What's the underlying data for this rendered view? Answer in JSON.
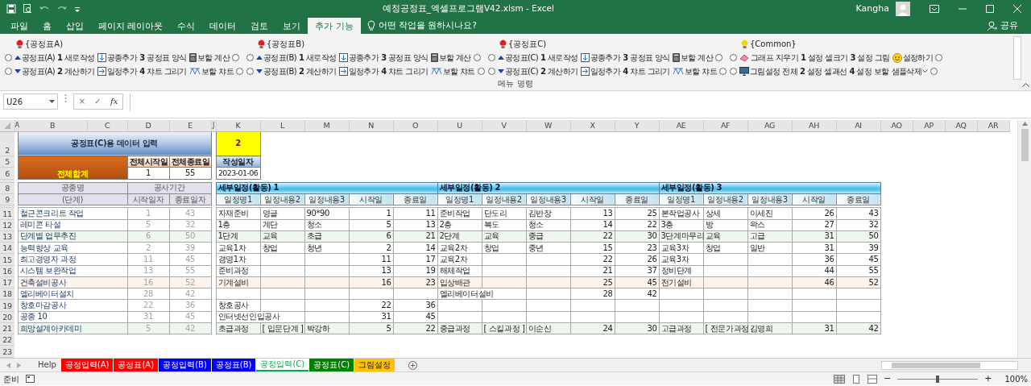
{
  "title_bar": {
    "title": "예정공정표_엑셀프로그램V42.xlsm  -  Excel",
    "user": "Kangha"
  },
  "menu_tabs": [
    {
      "label": "파일",
      "selected": false
    },
    {
      "label": "홈",
      "selected": false
    },
    {
      "label": "삽입",
      "selected": false
    },
    {
      "label": "페이지 레이아웃",
      "selected": false
    },
    {
      "label": "수식",
      "selected": false
    },
    {
      "label": "데이터",
      "selected": false
    },
    {
      "label": "검토",
      "selected": false
    },
    {
      "label": "보기",
      "selected": false
    },
    {
      "label": "추가 기능",
      "selected": true
    }
  ],
  "tell_me": "어떤 작업을 원하시나요?",
  "share": "공유",
  "ribbon": {
    "group_label": "메뉴 명령",
    "groups": [
      {
        "heading": "{공정표A)",
        "color": "#e02020",
        "rows": [
          {
            "left_checked": false,
            "right_checked": false,
            "items": [
              {
                "label": "공정표(A)",
                "kind": "up"
              },
              {
                "label": "**1** 새로작성",
                "kind": "command"
              },
              {
                "label": "공종추가",
                "kind": "insert-down"
              },
              {
                "label": "**3** 공정표 양식",
                "kind": "command"
              },
              {
                "label": "보할 계산",
                "kind": "calc"
              }
            ]
          },
          {
            "left_checked": false,
            "right_checked": false,
            "items": [
              {
                "label": "공정표(A)",
                "kind": "down"
              },
              {
                "label": "**2** 계산하기",
                "kind": "command"
              },
              {
                "label": "일정추가",
                "kind": "insert-right"
              },
              {
                "label": "**4** 챠트 그리기",
                "kind": "command"
              },
              {
                "label": "보할 챠트",
                "kind": "chart"
              }
            ]
          }
        ]
      },
      {
        "heading": "{공정표B)",
        "color": "#e02020",
        "rows": [
          {
            "left_checked": false,
            "right_checked": false,
            "items": [
              {
                "label": "공정표(B)",
                "kind": "up"
              },
              {
                "label": "**1** 새로작성",
                "kind": "command"
              },
              {
                "label": "공종추가",
                "kind": "insert-down"
              },
              {
                "label": "**3** 공정표 양식",
                "kind": "command"
              },
              {
                "label": "보할 계산",
                "kind": "calc"
              }
            ]
          },
          {
            "left_checked": false,
            "right_checked": false,
            "items": [
              {
                "label": "공정표(B)",
                "kind": "down"
              },
              {
                "label": "**2** 계산하기",
                "kind": "command"
              },
              {
                "label": "일정추가",
                "kind": "insert-right"
              },
              {
                "label": "**4** 챠트 그리기",
                "kind": "command"
              },
              {
                "label": "보할 챠트",
                "kind": "chart"
              }
            ]
          }
        ]
      },
      {
        "heading": "{공정표C)",
        "color": "#e02020",
        "rows": [
          {
            "left_checked": false,
            "right_checked": false,
            "items": [
              {
                "label": "공정표(C)",
                "kind": "up"
              },
              {
                "label": "**1** 새로작성",
                "kind": "command"
              },
              {
                "label": "공종추가",
                "kind": "insert-down"
              },
              {
                "label": "**3** 공정표 양식",
                "kind": "command"
              },
              {
                "label": "보할 계산",
                "kind": "calc"
              }
            ]
          },
          {
            "left_checked": false,
            "right_checked": false,
            "items": [
              {
                "label": "공정표(C)",
                "kind": "down"
              },
              {
                "label": "**2** 계산하기",
                "kind": "command"
              },
              {
                "label": "일정추가",
                "kind": "insert-right"
              },
              {
                "label": "**4** 챠트 그리기",
                "kind": "command"
              },
              {
                "label": "보할 챠트",
                "kind": "chart"
              }
            ]
          }
        ]
      },
      {
        "heading": "{Common}",
        "color": "#f5d800",
        "rows": [
          {
            "left_checked": false,
            "right_checked": false,
            "items": [
              {
                "label": "그래프 지우기",
                "kind": "eraser"
              },
              {
                "label": "**1** 설정 셀크기",
                "kind": "command"
              },
              {
                "label": "**3** 설정 그림",
                "kind": "command"
              },
              {
                "label": "설정하기",
                "kind": "smiley"
              }
            ]
          },
          {
            "left_checked": false,
            "right_checked": false,
            "items": [
              {
                "label": "그림설정 전체",
                "kind": "monitor"
              },
              {
                "label": "**2** 설정 셀괘선",
                "kind": "command"
              },
              {
                "label": "**4** 설정 보할",
                "kind": "command"
              },
              {
                "label": "샘플삭제",
                "kind": "dropdown"
              }
            ]
          }
        ]
      }
    ]
  },
  "formula_bar": {
    "name_box": "U26",
    "cancel": "×",
    "enter": "✓",
    "function": "fx"
  },
  "sheet": {
    "columns": [
      "A",
      "B",
      "C",
      "D",
      "E",
      "J",
      "K",
      "L",
      "M",
      "N",
      "O",
      "U",
      "V",
      "W",
      "X",
      "Y",
      "AE",
      "AF",
      "AG",
      "AH",
      "AI",
      "AO",
      "AP",
      "AQ",
      "AR"
    ],
    "row_numbers": [
      "2",
      "5",
      "6",
      "8",
      "9",
      "11",
      "12",
      "13",
      "14",
      "15",
      "16",
      "17",
      "18",
      "19",
      "20",
      "21",
      "22",
      "23"
    ],
    "header": {
      "title": "공정표(C)용 데이터 입력",
      "counter": "2",
      "summary_label": "전체합계",
      "start_label": "전체시작일",
      "end_label": "전체종료일",
      "start": "1",
      "end": "55",
      "date_label": "작성일자",
      "date": "2023-01-06"
    },
    "left_table": {
      "name_header": "공종명",
      "name_subheader": "(단계)",
      "period_header": "공사기간",
      "start_header": "시작일자",
      "end_header": "종료일자",
      "rows": [
        {
          "name": "철근콘크리트 작업",
          "start": "1",
          "end": "43"
        },
        {
          "name": "레미콘 타설",
          "start": "5",
          "end": "32"
        },
        {
          "name": "단계별 업무추진",
          "start": "6",
          "end": "50",
          "color": "#edf7ee"
        },
        {
          "name": "능력향상 교육",
          "start": "2",
          "end": "39"
        },
        {
          "name": "최고경영자 과정",
          "start": "11",
          "end": "45"
        },
        {
          "name": "시스템 보완작업",
          "start": "13",
          "end": "55"
        },
        {
          "name": "건축설비공사",
          "start": "16",
          "end": "52",
          "color": "#fdf3ec"
        },
        {
          "name": "엘리베이터설치",
          "start": "28",
          "end": "42"
        },
        {
          "name": "창호마감공사",
          "start": "22",
          "end": "36"
        },
        {
          "name": "공종 10",
          "start": "31",
          "end": "45"
        },
        {
          "name": "희망설계아카데미",
          "start": "5",
          "end": "42",
          "color": "#edf7ee"
        }
      ]
    },
    "blocks": [
      {
        "title": "세부일정(활동) 1",
        "columns": [
          "일정명1",
          "일정내용2",
          "일정내용3",
          "시작일",
          "종료일"
        ],
        "rows": [
          {
            "kind": "task",
            "name": "자재준비",
            "content2": "영글",
            "content3": "90*90",
            "start": "1",
            "end": "11"
          },
          {
            "kind": "task",
            "name": "1층",
            "content2": "계단",
            "content3": "청소",
            "start": "5",
            "end": "13"
          },
          {
            "kind": "task",
            "name": "1단계",
            "content2": "교육",
            "content3": "초급",
            "start": "6",
            "end": "21",
            "color": "#edf7ee"
          },
          {
            "kind": "task",
            "name": "교육1차",
            "content2": "창업",
            "content3": "청년",
            "start": "2",
            "end": "14"
          },
          {
            "kind": "task",
            "name": "경영1차",
            "start": "11",
            "end": "17"
          },
          {
            "kind": "task",
            "name": "준비과정",
            "start": "13",
            "end": "19"
          },
          {
            "kind": "task",
            "name": "기계설비",
            "start": "16",
            "end": "23",
            "color": "#fdf3ec"
          },
          {
            "kind": "task"
          },
          {
            "kind": "task",
            "name": "창호공사",
            "start": "22",
            "end": "36"
          },
          {
            "kind": "task",
            "name": "인터넷선인입공사",
            "start": "31",
            "end": "45"
          },
          {
            "kind": "summary",
            "name": "초급과정",
            "content2": "[ 입문단계 ]",
            "content3": "박강하",
            "start": "5",
            "end": "22",
            "color": "#edf7ee"
          }
        ]
      },
      {
        "title": "세부일정(활동) 2",
        "columns": [
          "일정명1",
          "일정내용2",
          "일정내용3",
          "시작일",
          "종료일"
        ],
        "rows": [
          {
            "kind": "task",
            "name": "준비작업",
            "content2": "단도리",
            "content3": "김반장",
            "start": "13",
            "end": "25"
          },
          {
            "kind": "task",
            "name": "2층",
            "content2": "복도",
            "content3": "청소",
            "start": "14",
            "end": "22"
          },
          {
            "kind": "task",
            "name": "2단계",
            "content2": "교육",
            "content3": "중급",
            "start": "22",
            "end": "30",
            "color": "#edf7ee"
          },
          {
            "kind": "task",
            "name": "교육2차",
            "content2": "창업",
            "content3": "중년",
            "start": "15",
            "end": "23"
          },
          {
            "kind": "task",
            "name": "교육2차",
            "start": "22",
            "end": "26"
          },
          {
            "kind": "task",
            "name": "해체작업",
            "start": "21",
            "end": "37"
          },
          {
            "kind": "task",
            "name": "입상배관",
            "start": "25",
            "end": "45",
            "color": "#fdf3ec"
          },
          {
            "kind": "task",
            "name": "엘리베이터설비",
            "start": "28",
            "end": "42"
          },
          {
            "kind": "task"
          },
          {
            "kind": "task"
          },
          {
            "kind": "summary",
            "name": "중급과정",
            "content2": "[ 스킬과정 ]",
            "content3": "이순신",
            "start": "24",
            "end": "30",
            "color": "#edf7ee"
          }
        ]
      },
      {
        "title": "세부일정(활동) 3",
        "columns": [
          "일정명1",
          "일정내용2",
          "일정내용3",
          "시작일",
          "종료일"
        ],
        "rows": [
          {
            "kind": "task",
            "name": "본작업공사",
            "content2": "상세",
            "content3": "이세진",
            "start": "26",
            "end": "43"
          },
          {
            "kind": "task",
            "name": "3층",
            "content2": "방",
            "content3": "왁스",
            "start": "27",
            "end": "32"
          },
          {
            "kind": "task",
            "name": "3단계마무리",
            "content2": "교육",
            "content3": "고급",
            "start": "31",
            "end": "50",
            "color": "#edf7ee"
          },
          {
            "kind": "task",
            "name": "교육3차",
            "content2": "창업",
            "content3": "일반",
            "start": "31",
            "end": "39"
          },
          {
            "kind": "task",
            "name": "교육3차",
            "start": "36",
            "end": "45"
          },
          {
            "kind": "task",
            "name": "정비단계",
            "start": "44",
            "end": "55"
          },
          {
            "kind": "task",
            "name": "전기설비",
            "start": "46",
            "end": "52",
            "color": "#fdf3ec"
          },
          {
            "kind": "task"
          },
          {
            "kind": "task"
          },
          {
            "kind": "task"
          },
          {
            "kind": "summary",
            "name": "고급과정",
            "content2": "[ 전문가과정",
            "content3": "김영희",
            "start": "31",
            "end": "42",
            "color": "#edf7ee"
          }
        ]
      }
    ]
  },
  "sheet_tabs": [
    {
      "label": "Help",
      "selected": false
    },
    {
      "label": "공정입력(A)",
      "color": "#ff0000",
      "selected": false
    },
    {
      "label": "공정표(A)",
      "color": "#ff0000",
      "selected": false
    },
    {
      "label": "공정입력(B)",
      "color": "#0000ff",
      "selected": false
    },
    {
      "label": "공정표(B)",
      "color": "#0000ff",
      "selected": false
    },
    {
      "label": "공정입력(C)",
      "color": "#00b050",
      "selected": true
    },
    {
      "label": "공정표(C)",
      "color": "#008000",
      "selected": false
    },
    {
      "label": "그림설정",
      "color": "#ffc000",
      "selected": false
    }
  ],
  "status_bar": {
    "status": "준비",
    "zoom_out": "−",
    "zoom_in": "+",
    "zoom": "100%",
    "level": 0.5
  }
}
